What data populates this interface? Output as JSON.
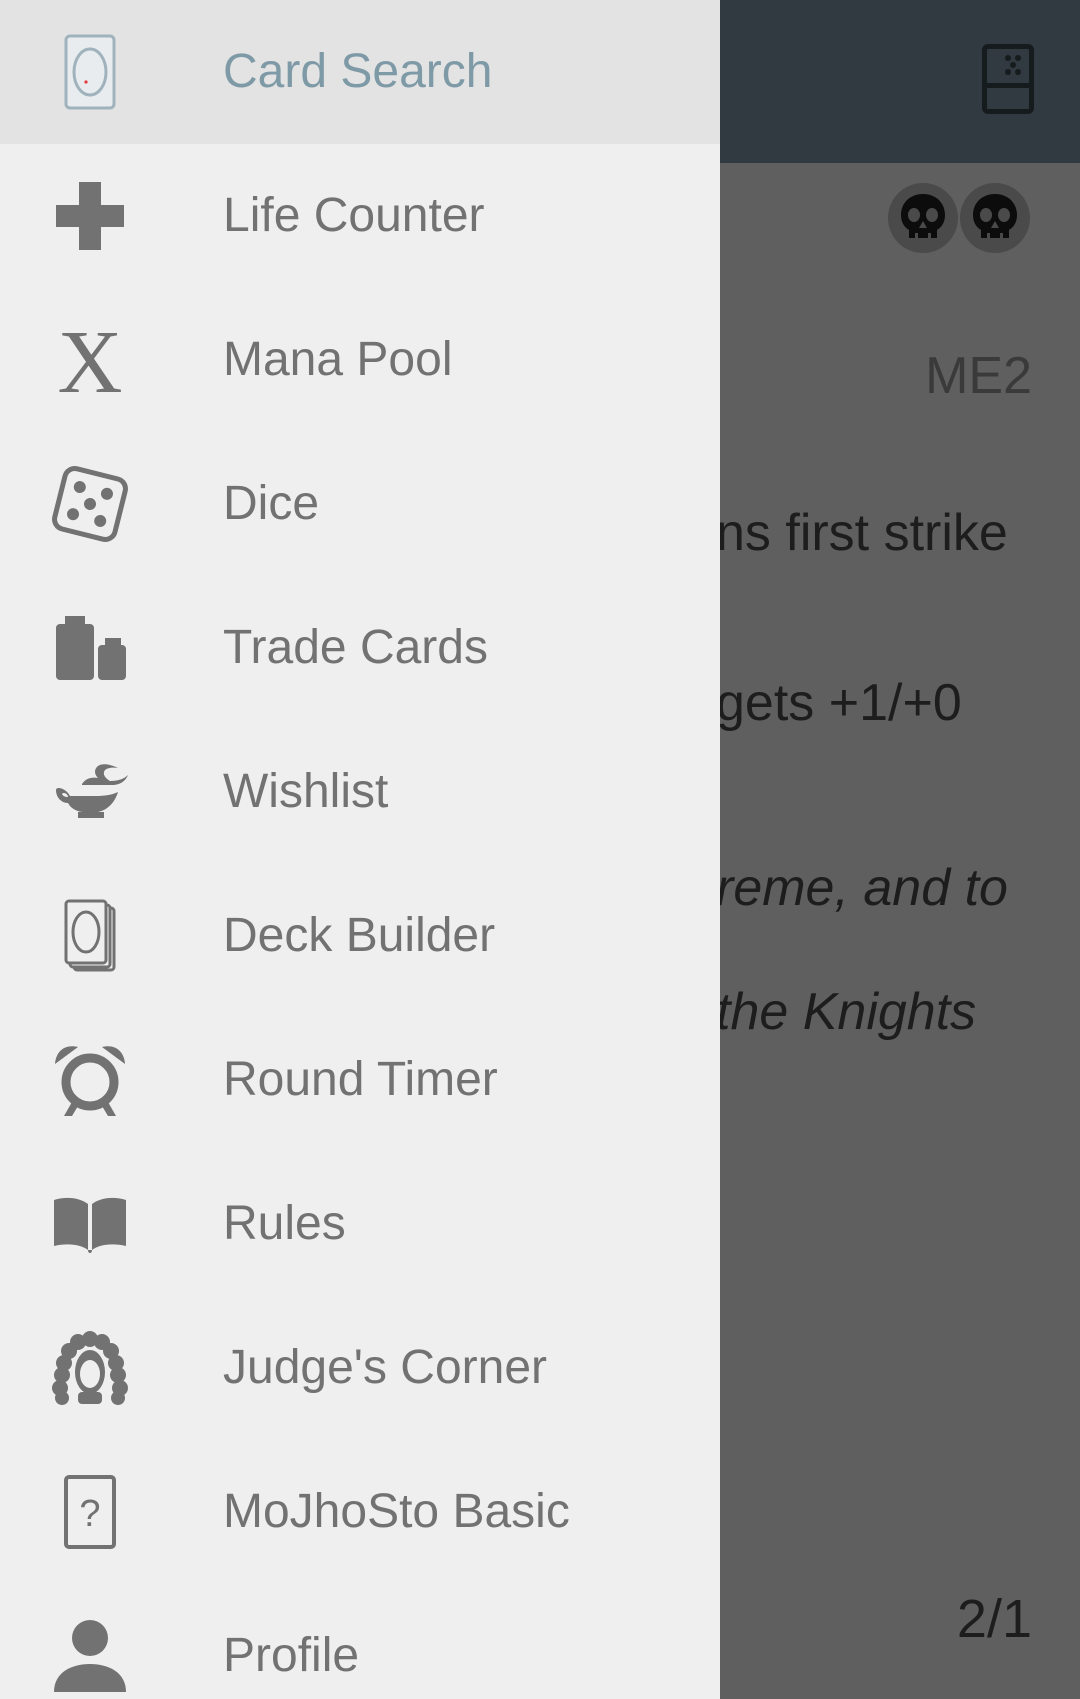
{
  "background": {
    "set_code": "ME2",
    "rules_lines": [
      "ns first strike",
      "gets +1/+0"
    ],
    "flavor_lines": [
      "reme, and to",
      "the Knights"
    ],
    "power_toughness": "2/1",
    "mana_cost_icons": [
      "black-mana-skull-icon",
      "black-mana-skull-icon"
    ],
    "toolbar_icon": "library-icon"
  },
  "drawer": {
    "items": [
      {
        "label": "Card Search",
        "icon": "card-search-icon",
        "selected": true
      },
      {
        "label": "Life Counter",
        "icon": "plus-icon",
        "selected": false
      },
      {
        "label": "Mana Pool",
        "icon": "x-mana-icon",
        "selected": false
      },
      {
        "label": "Dice",
        "icon": "dice-icon",
        "selected": false
      },
      {
        "label": "Trade Cards",
        "icon": "weights-icon",
        "selected": false
      },
      {
        "label": "Wishlist",
        "icon": "genie-lamp-icon",
        "selected": false
      },
      {
        "label": "Deck Builder",
        "icon": "card-stack-icon",
        "selected": false
      },
      {
        "label": "Round Timer",
        "icon": "alarm-clock-icon",
        "selected": false
      },
      {
        "label": "Rules",
        "icon": "book-icon",
        "selected": false
      },
      {
        "label": "Judge's Corner",
        "icon": "judge-wig-icon",
        "selected": false
      },
      {
        "label": "MoJhoSto Basic",
        "icon": "question-card-icon",
        "selected": false
      },
      {
        "label": "Profile",
        "icon": "person-icon",
        "selected": false
      }
    ]
  },
  "colors": {
    "drawer_bg": "#efefef",
    "selected_bg": "#e3e3e3",
    "selected_text": "#7f9aa7",
    "item_text": "#727272",
    "icon": "#727272",
    "toolbar": "#313a40",
    "scrim_bg": "#5f5f5f"
  }
}
